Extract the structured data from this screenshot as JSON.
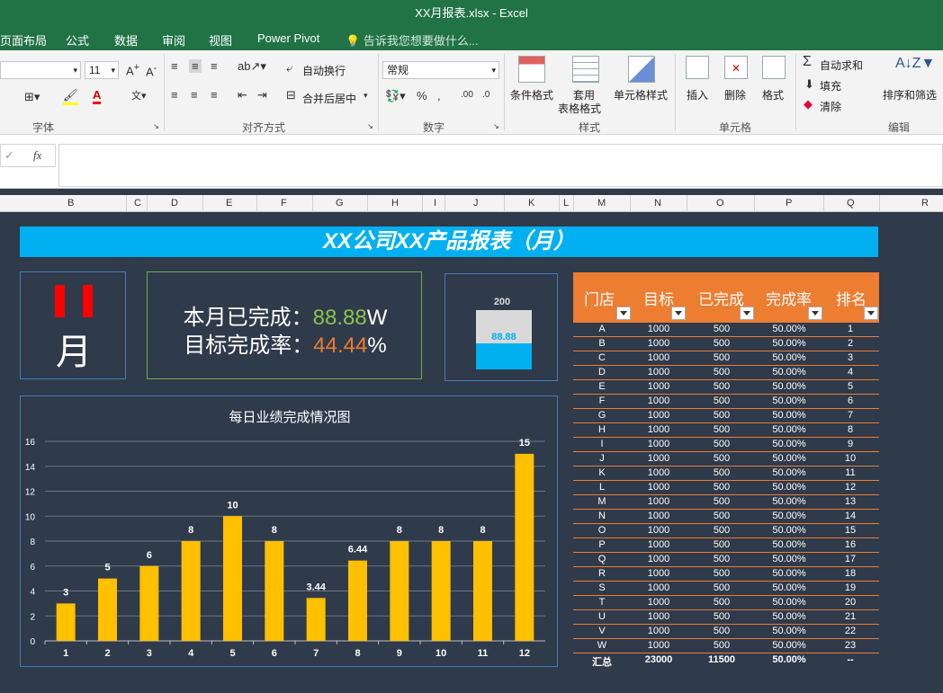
{
  "window": {
    "title": "XX月报表.xlsx - Excel"
  },
  "menu": {
    "tabs": [
      "页面布局",
      "公式",
      "数据",
      "审阅",
      "视图",
      "Power Pivot"
    ],
    "tell_me": "告诉我您想要做什么..."
  },
  "ribbon": {
    "font_size": "11",
    "groups": {
      "font": "字体",
      "alignment": "对齐方式",
      "number": "数字",
      "styles": "样式",
      "cells": "单元格",
      "editing": "编辑"
    },
    "wrap_text": "自动换行",
    "merge_center": "合并后居中",
    "number_format": "常规",
    "conditional_format": "条件格式",
    "table_format_1": "套用",
    "table_format_2": "表格格式",
    "cell_styles": "单元格样式",
    "insert": "插入",
    "delete": "删除",
    "format": "格式",
    "autosum": "自动求和",
    "fill": "填充",
    "clear": "清除",
    "sort_filter": "排序和筛选"
  },
  "columns": [
    "B",
    "C",
    "D",
    "E",
    "F",
    "G",
    "H",
    "I",
    "J",
    "K",
    "L",
    "M",
    "N",
    "O",
    "P",
    "Q",
    "R"
  ],
  "sheet": {
    "title": "XX公司XX产品报表（月）",
    "month_char": "月",
    "summary_label1": "本月已完成：",
    "summary_value1": "88.88",
    "summary_unit1": "W",
    "summary_label2": "目标完成率：",
    "summary_value2": "44.44",
    "summary_unit2": "%",
    "gauge_target": "200",
    "gauge_value": "88.88",
    "gauge_fraction": 0.4444
  },
  "chart_data": {
    "type": "bar",
    "title": "每日业绩完成情况图",
    "categories": [
      "1",
      "2",
      "3",
      "4",
      "5",
      "6",
      "7",
      "8",
      "9",
      "10",
      "11",
      "12"
    ],
    "values": [
      3,
      5,
      6,
      8,
      10,
      8,
      3.44,
      6.44,
      8,
      8,
      8,
      15
    ],
    "ylim": [
      0,
      16
    ],
    "yticks": [
      0,
      2,
      4,
      6,
      8,
      10,
      12,
      14,
      16
    ],
    "grid": true,
    "color": "#ffc000"
  },
  "table": {
    "headers": [
      "门店",
      "目标",
      "已完成",
      "完成率",
      "排名"
    ],
    "rows": [
      [
        "A",
        "1000",
        "500",
        "50.00%",
        "1"
      ],
      [
        "B",
        "1000",
        "500",
        "50.00%",
        "2"
      ],
      [
        "C",
        "1000",
        "500",
        "50.00%",
        "3"
      ],
      [
        "D",
        "1000",
        "500",
        "50.00%",
        "4"
      ],
      [
        "E",
        "1000",
        "500",
        "50.00%",
        "5"
      ],
      [
        "F",
        "1000",
        "500",
        "50.00%",
        "6"
      ],
      [
        "G",
        "1000",
        "500",
        "50.00%",
        "7"
      ],
      [
        "H",
        "1000",
        "500",
        "50.00%",
        "8"
      ],
      [
        "I",
        "1000",
        "500",
        "50.00%",
        "9"
      ],
      [
        "J",
        "1000",
        "500",
        "50.00%",
        "10"
      ],
      [
        "K",
        "1000",
        "500",
        "50.00%",
        "11"
      ],
      [
        "L",
        "1000",
        "500",
        "50.00%",
        "12"
      ],
      [
        "M",
        "1000",
        "500",
        "50.00%",
        "13"
      ],
      [
        "N",
        "1000",
        "500",
        "50.00%",
        "14"
      ],
      [
        "O",
        "1000",
        "500",
        "50.00%",
        "15"
      ],
      [
        "P",
        "1000",
        "500",
        "50.00%",
        "16"
      ],
      [
        "Q",
        "1000",
        "500",
        "50.00%",
        "17"
      ],
      [
        "R",
        "1000",
        "500",
        "50.00%",
        "18"
      ],
      [
        "S",
        "1000",
        "500",
        "50.00%",
        "19"
      ],
      [
        "T",
        "1000",
        "500",
        "50.00%",
        "20"
      ],
      [
        "U",
        "1000",
        "500",
        "50.00%",
        "21"
      ],
      [
        "V",
        "1000",
        "500",
        "50.00%",
        "22"
      ],
      [
        "W",
        "1000",
        "500",
        "50.00%",
        "23"
      ]
    ],
    "total": [
      "汇总",
      "23000",
      "11500",
      "50.00%",
      "--"
    ]
  },
  "colors": {
    "excel_green": "#217346",
    "banner": "#00b0f0",
    "bar": "#ffc000",
    "table_head": "#ed7d31",
    "sheet_bg": "#2f3a4b"
  }
}
